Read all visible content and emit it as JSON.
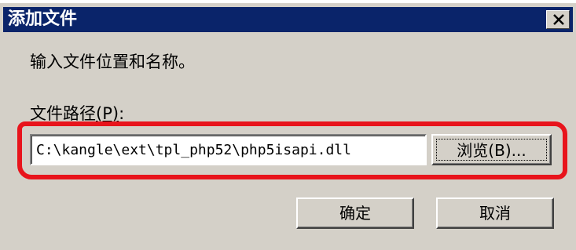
{
  "dialog": {
    "title": "添加文件",
    "instruction": "输入文件位置和名称。",
    "path_label_prefix": "文件路径",
    "path_label_mnemonic": "(P)",
    "path_label_suffix": ":",
    "path_value": "C:\\kangle\\ext\\tpl_php52\\php5isapi.dll",
    "browse_label": "浏览(B)...",
    "ok_label": "确定",
    "cancel_label": "取消",
    "close_icon": "close-icon"
  },
  "colors": {
    "titlebar": "#0a246a",
    "face": "#d4d0c8",
    "highlight": "#e8141c"
  }
}
